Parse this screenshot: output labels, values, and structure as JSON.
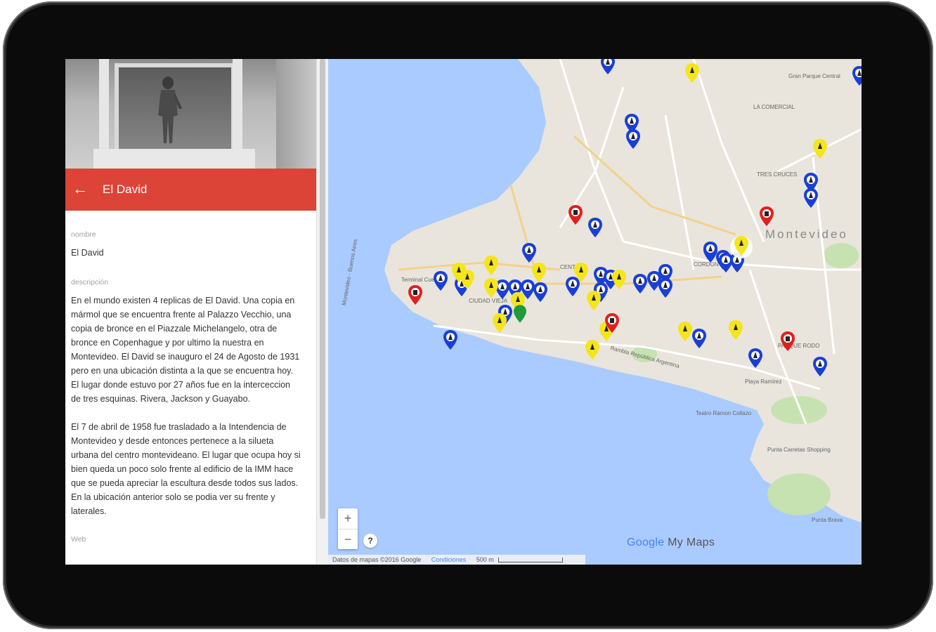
{
  "panel": {
    "title": "El David",
    "fields": [
      {
        "label": "nombre",
        "value": "El David"
      },
      {
        "label": "descripción",
        "paragraphs": [
          "En el mundo existen 4 replicas de El David. Una copia en mármol que se encuentra frente al Palazzo Vecchio, una copia de bronce en el Piazzale Michelangelo, otra de bronce en Copenhague y por ultimo la nuestra en Montevideo. El David se inauguro el 24 de Agosto de 1931 pero en una ubicación distinta a la que se encuentra hoy. El lugar donde estuvo por 27 años fue en la interceccion de tres esquinas. Rivera, Jackson y Guayabo.",
          "El 7 de abril de 1958 fue trasladado a la Intendencia de Montevideo y desde entonces pertenece a la silueta urbana del centro montevideano. El lugar que ocupa hoy si bien queda un poco solo frente al edificio de la IMM hace que se pueda apreciar la escultura desde todos sus lados. En la ubicación anterior solo se podia ver su frente y laterales."
        ]
      },
      {
        "label": "Web"
      }
    ],
    "icons": {
      "back": "arrow-back-icon"
    }
  },
  "map": {
    "city_label": "Montevideo",
    "labels": {
      "la_comercial": "LA COMERCIAL",
      "tres_cruces": "TRES CRUCES",
      "gran_parque": "Gran Parque Central",
      "terminal": "Terminal Cuelle",
      "rambla": "Montevideo - Buenos Aires",
      "ciudad_vieja": "CIUDAD VIEJA",
      "centro": "CENTRO",
      "cordon": "CORDON",
      "playa_ramirez": "Playa Ramírez",
      "teatro": "Teatro Ramon Collazo",
      "punta_carretas": "Punta Carretas Shopping",
      "punta_brava": "Punta Brava",
      "rambla_republica": "Rambla República Argentina",
      "parque_rodo": "PARQUE RODO"
    },
    "brand": {
      "google": "Google",
      "mymaps": "My Maps"
    },
    "attribution": {
      "data": "Datos de mapas ©2016 Google",
      "terms": "Condiciones",
      "scale": "500 m"
    },
    "zoom": {
      "in": "+",
      "out": "−"
    },
    "help": "?",
    "colors": {
      "water": "#aacbff",
      "land": "#e9e5dc",
      "park": "#c6e2b0",
      "road": "#ffffff",
      "pin_blue": "#1a3fd6",
      "pin_yellow": "#f5e51b",
      "pin_red": "#e02020",
      "pin_green": "#1e9b3a"
    }
  }
}
